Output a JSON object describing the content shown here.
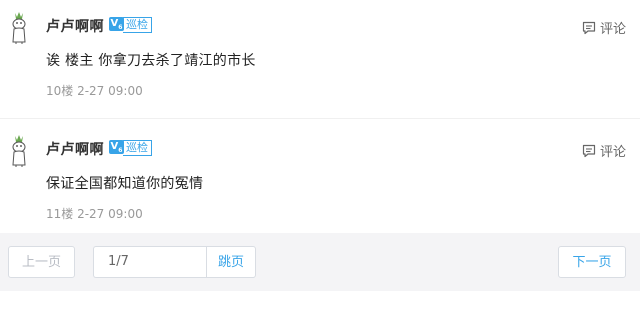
{
  "posts": [
    {
      "username": "卢卢啊啊",
      "badge_v": "V",
      "badge_v_sub": "6",
      "badge_role": "巡检",
      "comment_label": "评论",
      "content": "诶 楼主 你拿刀去杀了靖江的市长",
      "meta": "10楼 2-27 09:00"
    },
    {
      "username": "卢卢啊啊",
      "badge_v": "V",
      "badge_v_sub": "6",
      "badge_role": "巡检",
      "comment_label": "评论",
      "content": "保证全国都知道你的冤情",
      "meta": "11楼 2-27 09:00"
    }
  ],
  "pager": {
    "prev_label": "上一页",
    "page_value": "1/7",
    "jump_label": "跳页",
    "next_label": "下一页"
  },
  "colors": {
    "accent": "#38a4e8",
    "pager_bg": "#f4f4f6"
  }
}
